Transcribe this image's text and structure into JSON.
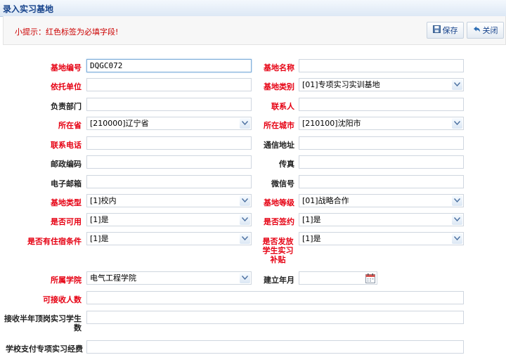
{
  "window": {
    "title": "录入实习基地"
  },
  "toolbar": {
    "hint": "小提示：红色标签为必填字段!",
    "save_label": "保存",
    "close_label": "关闭"
  },
  "form": {
    "base_code": {
      "label": "基地编号",
      "value": "DQGC072"
    },
    "base_name": {
      "label": "基地名称",
      "value": ""
    },
    "host_unit": {
      "label": "依托单位",
      "value": ""
    },
    "base_category": {
      "label": "基地类别",
      "value": "[01]专项实习实训基地"
    },
    "dept": {
      "label": "负责部门",
      "value": ""
    },
    "contact": {
      "label": "联系人",
      "value": ""
    },
    "province": {
      "label": "所在省",
      "value": "[210000]辽宁省"
    },
    "city": {
      "label": "所在城市",
      "value": "[210100]沈阳市"
    },
    "phone": {
      "label": "联系电话",
      "value": ""
    },
    "address": {
      "label": "通信地址",
      "value": ""
    },
    "postcode": {
      "label": "邮政编码",
      "value": ""
    },
    "fax": {
      "label": "传真",
      "value": ""
    },
    "email": {
      "label": "电子邮箱",
      "value": ""
    },
    "wechat": {
      "label": "微信号",
      "value": ""
    },
    "base_type": {
      "label": "基地类型",
      "value": "[1]校内"
    },
    "base_level": {
      "label": "基地等级",
      "value": "[01]战略合作"
    },
    "available": {
      "label": "是否可用",
      "value": "[1]是"
    },
    "signed": {
      "label": "是否签约",
      "value": "[1]是"
    },
    "lodging": {
      "label": "是否有住宿条件",
      "value": "[1]是"
    },
    "subsidy": {
      "label": "是否发放学生实习补贴",
      "value": "[1]是"
    },
    "college": {
      "label": "所属学院",
      "value": "电气工程学院"
    },
    "founded": {
      "label": "建立年月",
      "value": ""
    },
    "capacity": {
      "label": "可接收人数",
      "value": ""
    },
    "half_year": {
      "label": "接收半年顶岗实习学生数",
      "value": ""
    },
    "funding": {
      "label": "学校支付专项实习经费",
      "value": ""
    }
  }
}
